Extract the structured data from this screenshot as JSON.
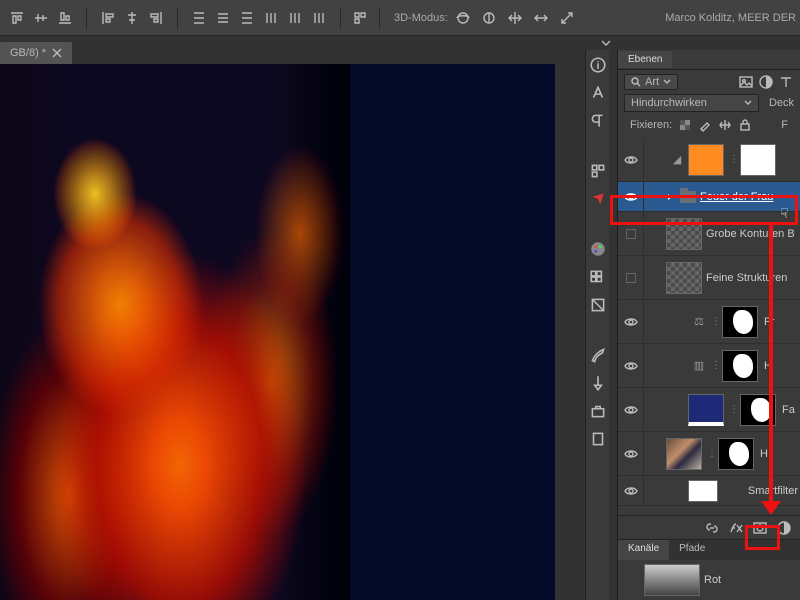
{
  "top": {
    "mode3d_label": "3D-Modus:",
    "author": "Marco Kolditz, MEER DER"
  },
  "doc_tab": {
    "title": "GB/8) *"
  },
  "panels": {
    "layers_tab": "Ebenen",
    "filter_label": "Art",
    "blend_mode": "Hindurchwirken",
    "opacity_label": "Deck",
    "lock_label": "Fixieren:",
    "fill_label": "F"
  },
  "layers": [
    {
      "name": "",
      "thumb": "solid-orange",
      "eye": true
    },
    {
      "name": "Feuer der Frau",
      "type": "group",
      "eye": true,
      "selected": true
    },
    {
      "name": "Grobe Konturen B",
      "thumb": "checker",
      "eye": false
    },
    {
      "name": "Feine Strukturen",
      "thumb": "checker",
      "eye": false
    },
    {
      "name": "Fr",
      "glyph": "balance",
      "mask": true,
      "eye": true
    },
    {
      "name": "H",
      "glyph": "crown",
      "mask": true,
      "eye": true
    },
    {
      "name": "Fa",
      "thumb": "navy",
      "mask": true,
      "eye": true
    },
    {
      "name": "H",
      "thumb": "photo",
      "mask": true,
      "eye": true
    },
    {
      "name": "Smartfilter",
      "thumb": "white",
      "eye": true,
      "short": true
    }
  ],
  "channels": {
    "tab_channels": "Kanäle",
    "tab_paths": "Pfade",
    "row1": "Rot"
  }
}
